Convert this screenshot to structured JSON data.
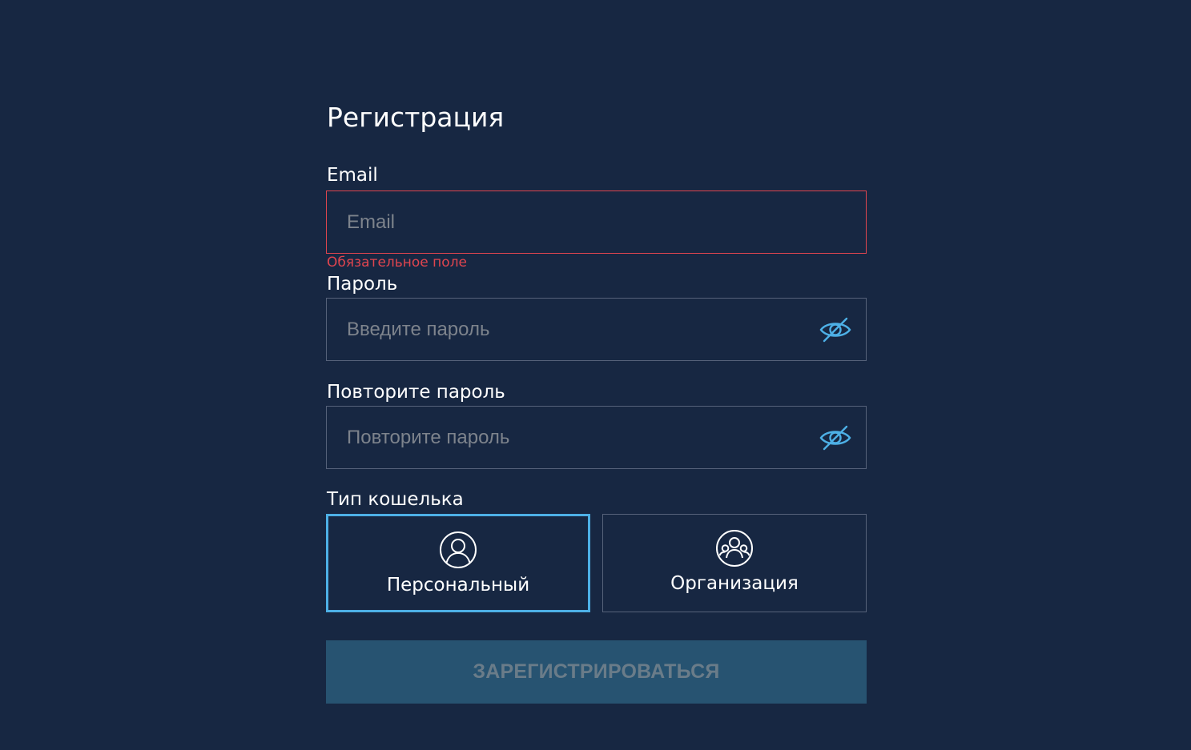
{
  "form": {
    "title": "Регистрация",
    "email": {
      "label": "Email",
      "placeholder": "Email",
      "value": "",
      "error": "Обязательное поле"
    },
    "password": {
      "label": "Пароль",
      "placeholder": "Введите пароль",
      "value": "",
      "toggle_icon": "eye-off-icon"
    },
    "repeat_password": {
      "label": "Повторите пароль",
      "placeholder": "Повторите пароль",
      "value": "",
      "toggle_icon": "eye-off-icon"
    },
    "wallet_type": {
      "label": "Тип кошелька",
      "options": [
        {
          "label": "Персональный",
          "icon": "user-icon",
          "selected": true
        },
        {
          "label": "Организация",
          "icon": "group-icon",
          "selected": false
        }
      ]
    },
    "submit_label": "ЗАРЕГИСТРИРОВАТЬСЯ"
  },
  "colors": {
    "background": "#172742",
    "error": "#e0454f",
    "accent": "#4db0e6",
    "button_bg": "#275371",
    "button_text": "#6a7c89"
  }
}
